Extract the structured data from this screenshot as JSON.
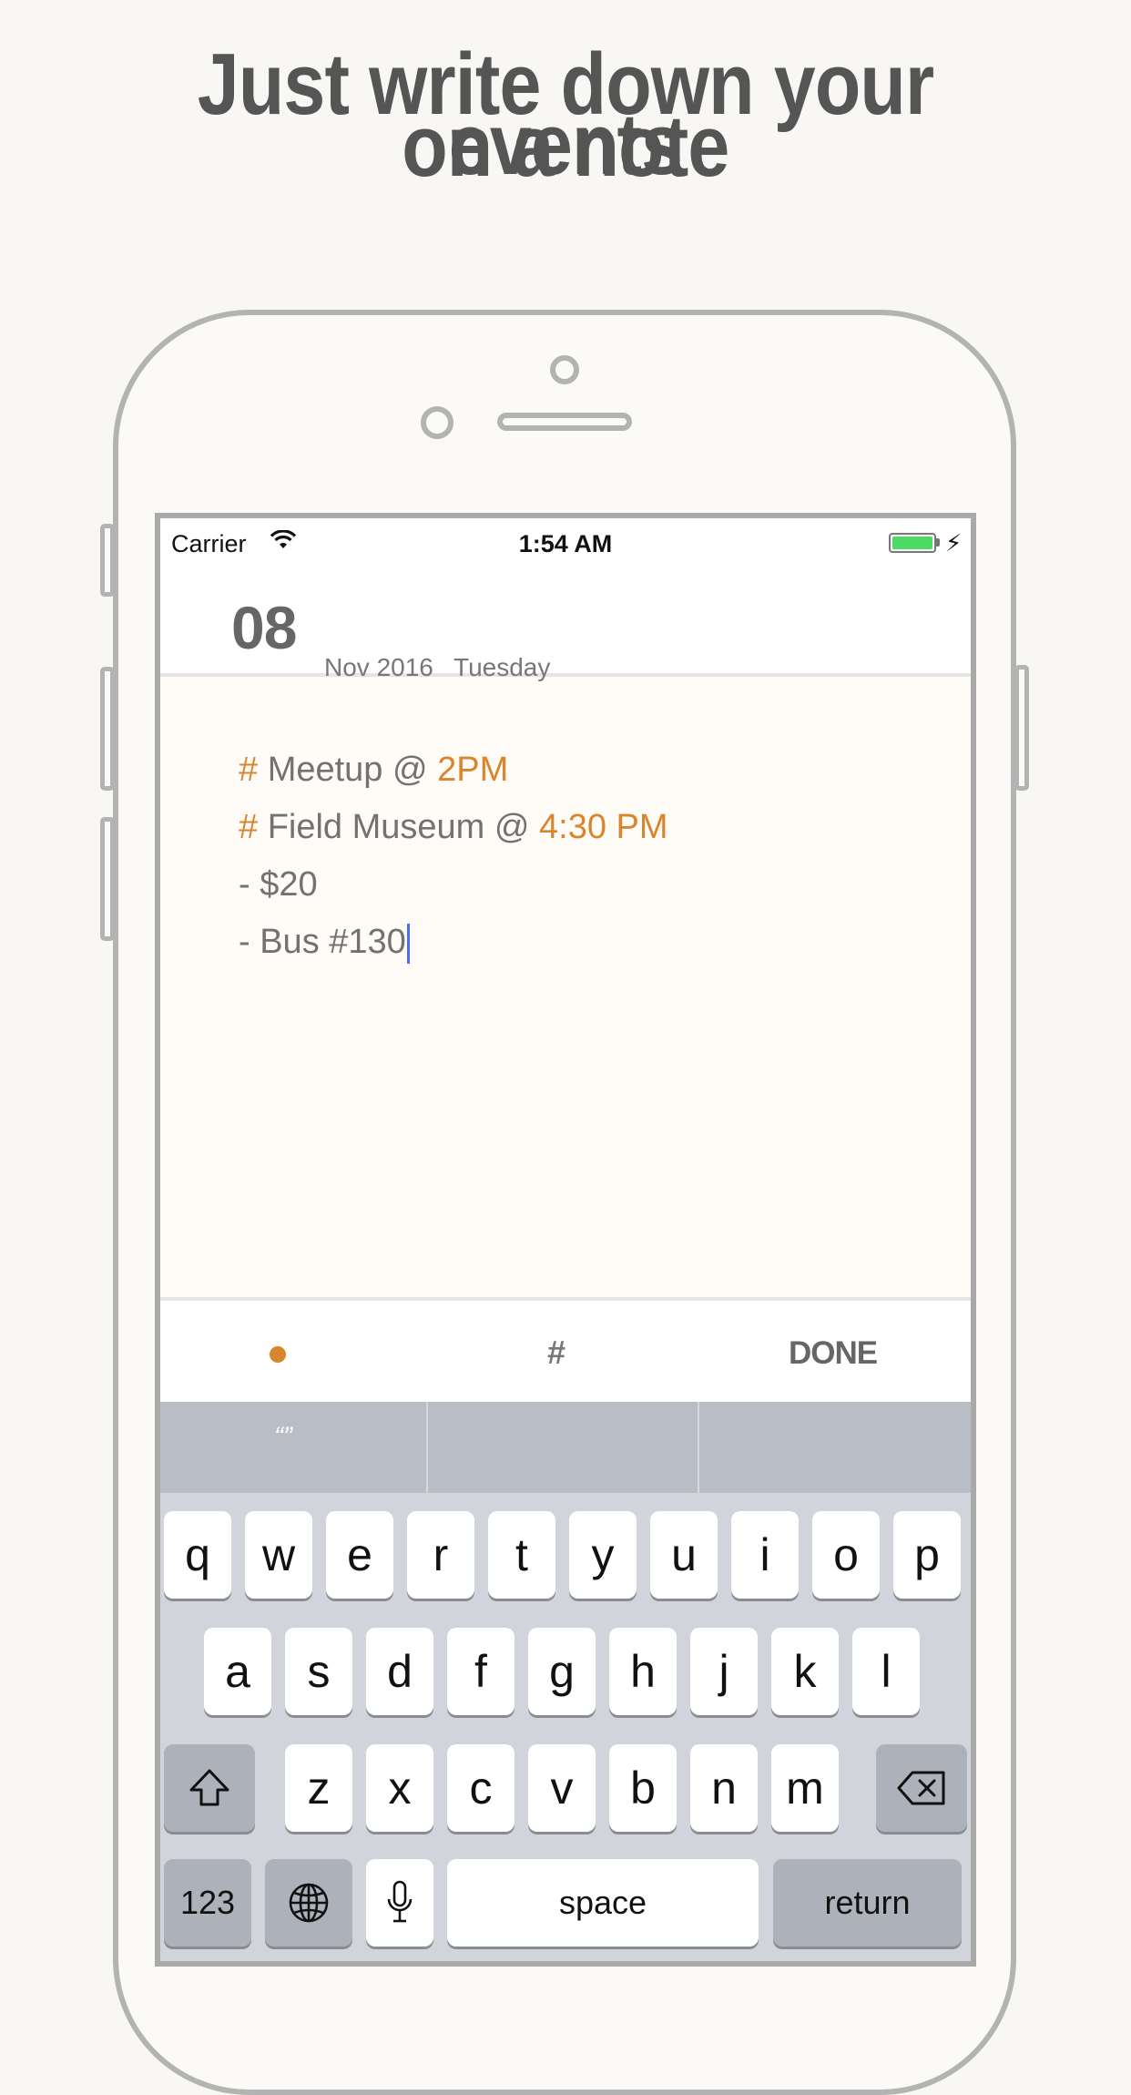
{
  "headline": {
    "line1": "Just write down your events",
    "line2": "on a note"
  },
  "status_bar": {
    "carrier": "Carrier",
    "time": "1:54 AM",
    "battery_color": "#4cd964"
  },
  "date_header": {
    "day": "08",
    "month_year": "Nov 2016",
    "weekday": "Tuesday"
  },
  "note": {
    "line1_hash": "#",
    "line1_text": " Meetup @ ",
    "line1_time": "2PM",
    "line2_hash": "#",
    "line2_text": " Field Museum @ ",
    "line2_time": "4:30 PM",
    "line3": "- $20",
    "line4": "- Bus #130",
    "accent_color": "#d9852e"
  },
  "toolbar": {
    "bullet_icon": "orange-dot",
    "hash_label": "#",
    "done_label": "DONE"
  },
  "keyboard": {
    "suggestion_1": "“”",
    "row1": [
      "q",
      "w",
      "e",
      "r",
      "t",
      "y",
      "u",
      "i",
      "o",
      "p"
    ],
    "row2": [
      "a",
      "s",
      "d",
      "f",
      "g",
      "h",
      "j",
      "k",
      "l"
    ],
    "row3": [
      "z",
      "x",
      "c",
      "v",
      "b",
      "n",
      "m"
    ],
    "numbers_label": "123",
    "space_label": "space",
    "return_label": "return",
    "shift_icon": "shift-icon",
    "delete_icon": "backspace-icon",
    "globe_icon": "globe-icon",
    "mic_icon": "microphone-icon"
  }
}
